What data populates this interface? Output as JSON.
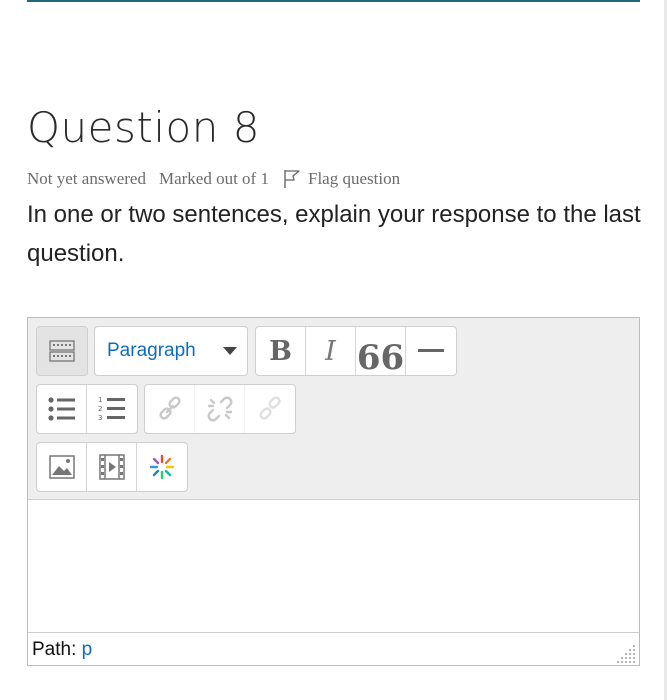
{
  "question": {
    "title": "Question 8",
    "state": "Not yet answered",
    "marks": "Marked out of 1",
    "flag_label": "Flag question",
    "text": "In one or two sentences, explain your response to the last question."
  },
  "editor": {
    "format_select": "Paragraph",
    "bold": "B",
    "italic": "I",
    "blockquote": "66",
    "path_label": "Path:",
    "path_value": "p"
  }
}
